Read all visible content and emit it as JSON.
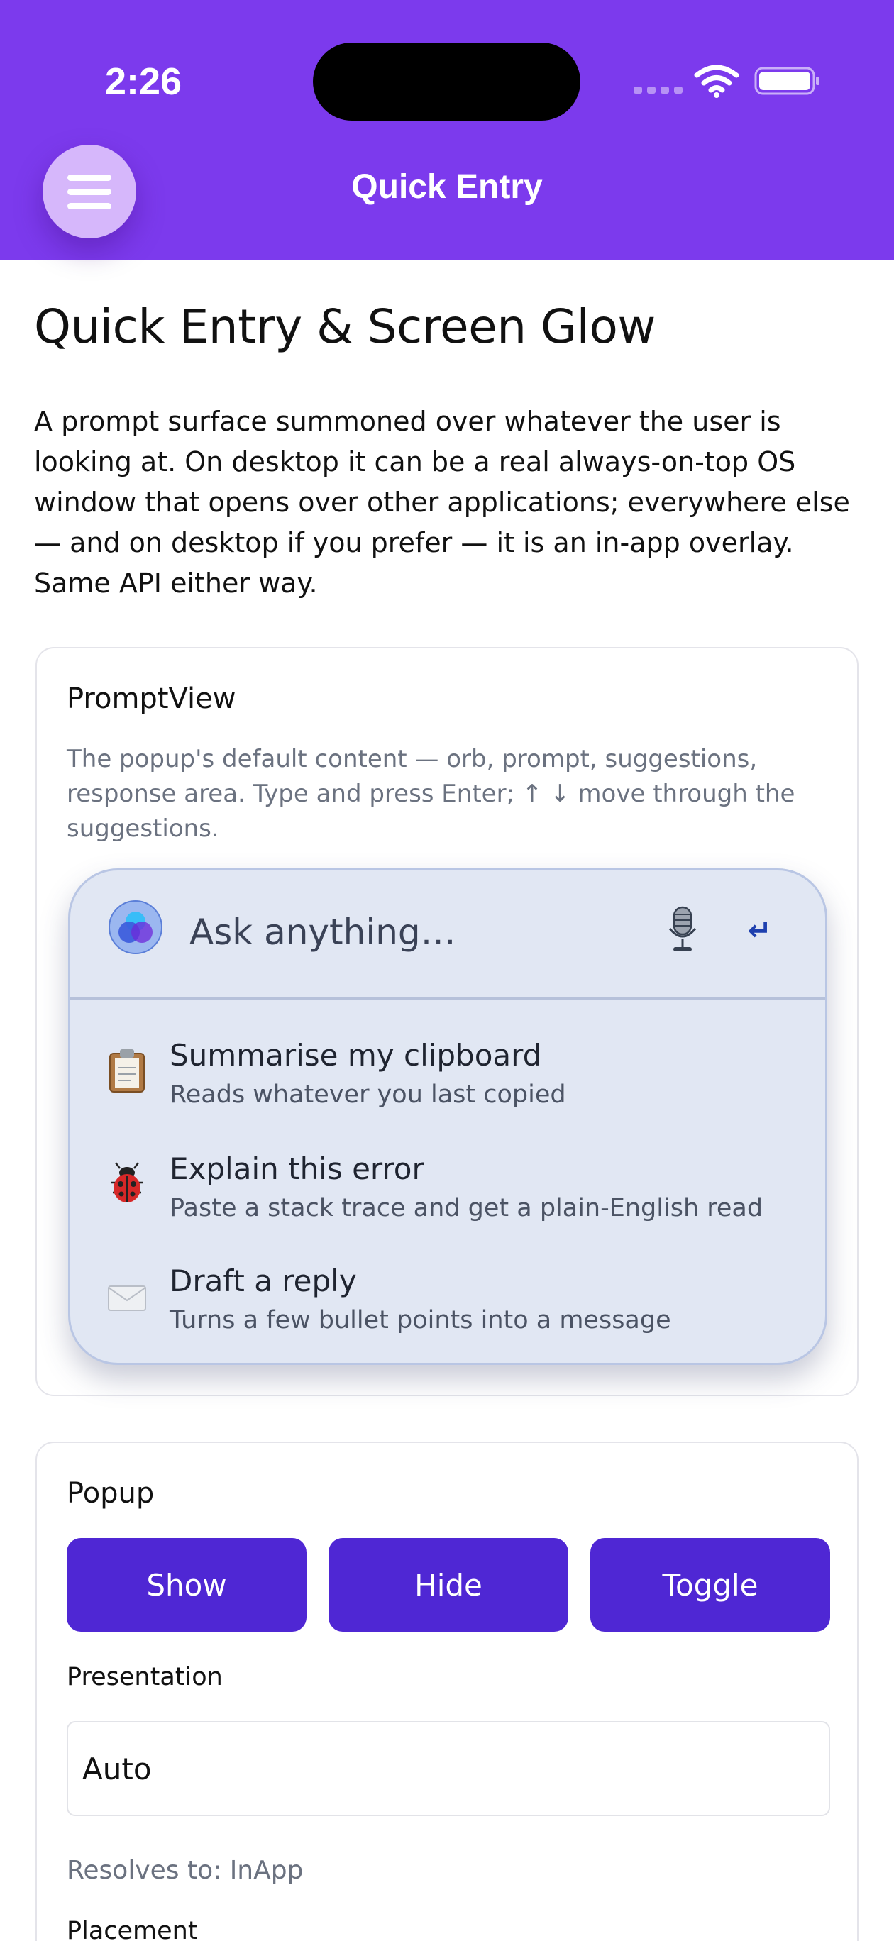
{
  "status_bar": {
    "time": "2:26"
  },
  "header": {
    "title": "Quick Entry",
    "menu_icon": "hamburger-icon",
    "color": "#7c3aed"
  },
  "page": {
    "title": "Quick Entry & Screen Glow",
    "intro": "A prompt surface summoned over whatever the user is looking at. On desktop it can be a real always-on-top OS window that opens over other applications; everywhere else — and on desktop if you prefer — it is an in-app overlay. Same API either way."
  },
  "prompt_view_card": {
    "title": "PromptView",
    "description": "The popup's default content — orb, prompt, suggestions, response area. Type and press Enter; ↑ ↓ move through the suggestions.",
    "prompt": {
      "placeholder": "Ask anything…",
      "enter_glyph": "↵"
    },
    "suggestions": [
      {
        "icon": "clipboard-icon",
        "title": "Summarise my clipboard",
        "subtitle": "Reads whatever you last copied"
      },
      {
        "icon": "ladybug-icon",
        "title": "Explain this error",
        "subtitle": "Paste a stack trace and get a plain-English read"
      },
      {
        "icon": "envelope-icon",
        "title": "Draft a reply",
        "subtitle": "Turns a few bullet points into a message"
      }
    ]
  },
  "popup_card": {
    "title": "Popup",
    "buttons": {
      "show": "Show",
      "hide": "Hide",
      "toggle": "Toggle"
    },
    "button_color": "#4f27d4",
    "presentation_label": "Presentation",
    "presentation_value": "Auto",
    "resolves_to": "Resolves to: InApp",
    "placement_label": "Placement"
  }
}
